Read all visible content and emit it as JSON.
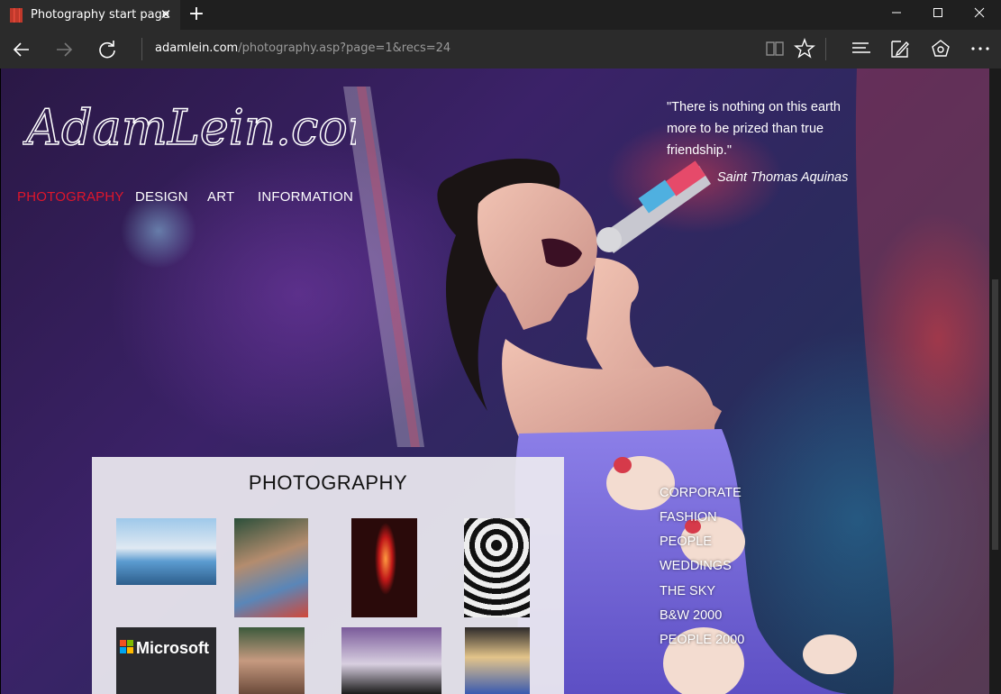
{
  "browser": {
    "tab_title": "Photography start page",
    "tab_close_glyph": "✕",
    "new_tab_glyph": "+",
    "minimize_glyph": "—",
    "maximize_glyph": "☐",
    "close_glyph": "✕",
    "url_host": "adamlein.com",
    "url_path": "/photography.asp?page=1&recs=24",
    "icons": [
      "back-icon",
      "forward-icon",
      "refresh-icon",
      "reading-view-icon",
      "favorite-star-icon",
      "hub-icon",
      "web-note-icon",
      "share-icon",
      "more-icon"
    ]
  },
  "site": {
    "logo_text": "AdamLein.com",
    "nav": [
      {
        "label": "PHOTOGRAPHY",
        "active": true
      },
      {
        "label": "DESIGN",
        "active": false
      },
      {
        "label": "ART",
        "active": false
      },
      {
        "label": "INFORMATION",
        "active": false
      }
    ],
    "quote": "\"There is nothing on this earth more to be prized than true friendship.\"",
    "quote_author": "Saint Thomas Aquinas"
  },
  "panel": {
    "title": "PHOTOGRAPHY",
    "thumbnail_text": "Microsoft"
  },
  "categories": [
    "CORPORATE",
    "FASHION",
    "PEOPLE",
    "WEDDINGS",
    "THE SKY",
    "B&W 2000",
    "PEOPLE 2000"
  ],
  "colors": {
    "active_nav": "#e0162b",
    "chrome_dark": "#1f1f1f",
    "chrome_mid": "#2b2b2b"
  }
}
